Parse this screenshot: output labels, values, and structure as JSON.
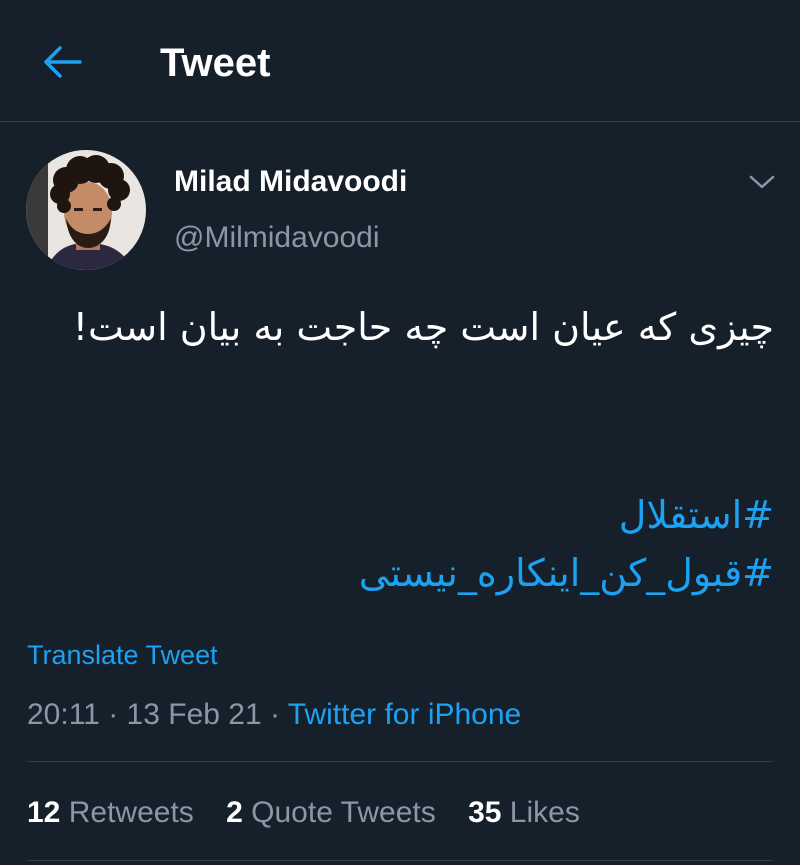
{
  "header": {
    "title": "Tweet",
    "back_icon": "arrow-left-icon"
  },
  "tweet": {
    "author_name": "Milad Midavoodi",
    "author_handle": "@Milmidavoodi",
    "text": "چیزی که عیان است چه حاجت به بیان است!",
    "hashtags": [
      "#استقلال",
      "#قبول_کن_اینکاره_نیستی"
    ],
    "translate_label": "Translate Tweet",
    "time": "20:11",
    "date": "13 Feb 21",
    "separator": "·",
    "source": "Twitter for iPhone",
    "more_icon": "chevron-down-icon"
  },
  "stats": {
    "retweets_count": "12",
    "retweets_label": "Retweets",
    "quotes_count": "2",
    "quotes_label": "Quote Tweets",
    "likes_count": "35",
    "likes_label": "Likes"
  },
  "colors": {
    "background": "#15202b",
    "accent": "#1da1f2",
    "secondary_text": "#8899a6",
    "divider": "#2f3b47"
  }
}
